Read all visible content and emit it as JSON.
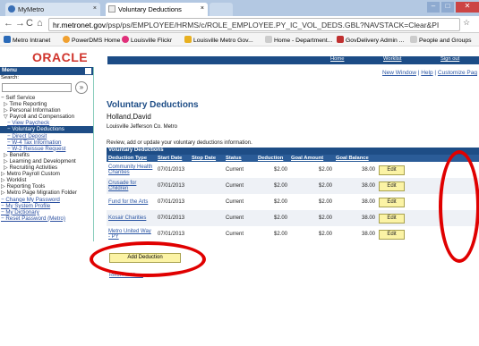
{
  "browser": {
    "tabs": [
      {
        "label": "MyMetro",
        "close": "×"
      },
      {
        "label": "Voluntary Deductions",
        "close": "×"
      }
    ],
    "url_host": "hr.metronet.gov",
    "url_path": "/psp/ps/EMPLOYEE/HRMS/c/ROLE_EMPLOYEE.PY_IC_VOL_DEDS.GBL?NAVSTACK=Clear&PI",
    "bookmarks": [
      {
        "label": "Metro Intranet",
        "color": "#2a6ab8"
      },
      {
        "label": "PowerDMS Home",
        "color": "#f0a030"
      },
      {
        "label": "Louisville Flickr",
        "color": "#e0307a"
      },
      {
        "label": "Louisville Metro Gov...",
        "color": "#e8b020"
      },
      {
        "label": "Home - Department...",
        "color": "#cccccc"
      },
      {
        "label": "GovDelivery Admin ...",
        "color": "#c03030"
      },
      {
        "label": "People and Groups",
        "color": "#cccccc"
      }
    ]
  },
  "header": {
    "logo": "ORACLE",
    "links": [
      "Home",
      "Worklist",
      "Sign out"
    ],
    "toplinks": [
      "New Window",
      "Help",
      "Customize Pag"
    ]
  },
  "menu": {
    "title": "Menu",
    "search_label": "Search:",
    "search_go": "»",
    "items": [
      "− Self Service",
      "▷ Time Reporting",
      "▷ Personal Information",
      "▽ Payroll and Compensation",
      "− View Paycheck",
      "− Voluntary Deductions",
      "− Direct Deposit",
      "− W-4 Tax Information",
      "− W-2 Reissue Request",
      "▷ Benefits",
      "▷ Learning and Development",
      "▷ Recruiting Activities",
      "▷ Metro Payroll Custom",
      "▷ Worklist",
      "▷ Reporting Tools",
      "▷ Metro Page Migration Folder",
      "− Change My Password",
      "− My System Profile",
      "− My Dictionary",
      "− Reset Password (Metro)"
    ]
  },
  "page": {
    "title": "Voluntary Deductions",
    "employee": "Holland,David",
    "department": "Louisville Jefferson Co. Metro",
    "instructions": "Review, add or update your voluntary deductions information.",
    "grid_title": "Voluntary Deductions",
    "columns": [
      "Deduction Type",
      "Start Date",
      "Stop Date",
      "Status",
      "Deduction",
      "Goal Amount",
      "Goal Balance",
      ""
    ],
    "rows": [
      {
        "type": "Community Health Charities",
        "start": "07/01/2013",
        "stop": "",
        "status": "Current",
        "deduction": "$2.00",
        "goal_amount": "$2.00",
        "goal_balance": "38.00",
        "action": "Edit"
      },
      {
        "type": "Crusade for Children",
        "start": "07/01/2013",
        "stop": "",
        "status": "Current",
        "deduction": "$2.00",
        "goal_amount": "$2.00",
        "goal_balance": "38.00",
        "action": "Edit"
      },
      {
        "type": "Fund for the Arts",
        "start": "07/01/2013",
        "stop": "",
        "status": "Current",
        "deduction": "$2.00",
        "goal_amount": "$2.00",
        "goal_balance": "38.00",
        "action": "Edit"
      },
      {
        "type": "Kosair Charities",
        "start": "07/01/2013",
        "stop": "",
        "status": "Current",
        "deduction": "$2.00",
        "goal_amount": "$2.00",
        "goal_balance": "38.00",
        "action": "Edit"
      },
      {
        "type": "Metro United Way - PY",
        "start": "07/01/2013",
        "stop": "",
        "status": "Current",
        "deduction": "$2.00",
        "goal_amount": "$2.00",
        "goal_balance": "38.00",
        "action": "Edit"
      }
    ],
    "add_button": "Add Deduction",
    "return_link": "Return to Menu"
  },
  "colors": {
    "header_blue": "#1e4d86",
    "button_yellow": "#fbf3a5",
    "annotation_red": "#e00000"
  }
}
